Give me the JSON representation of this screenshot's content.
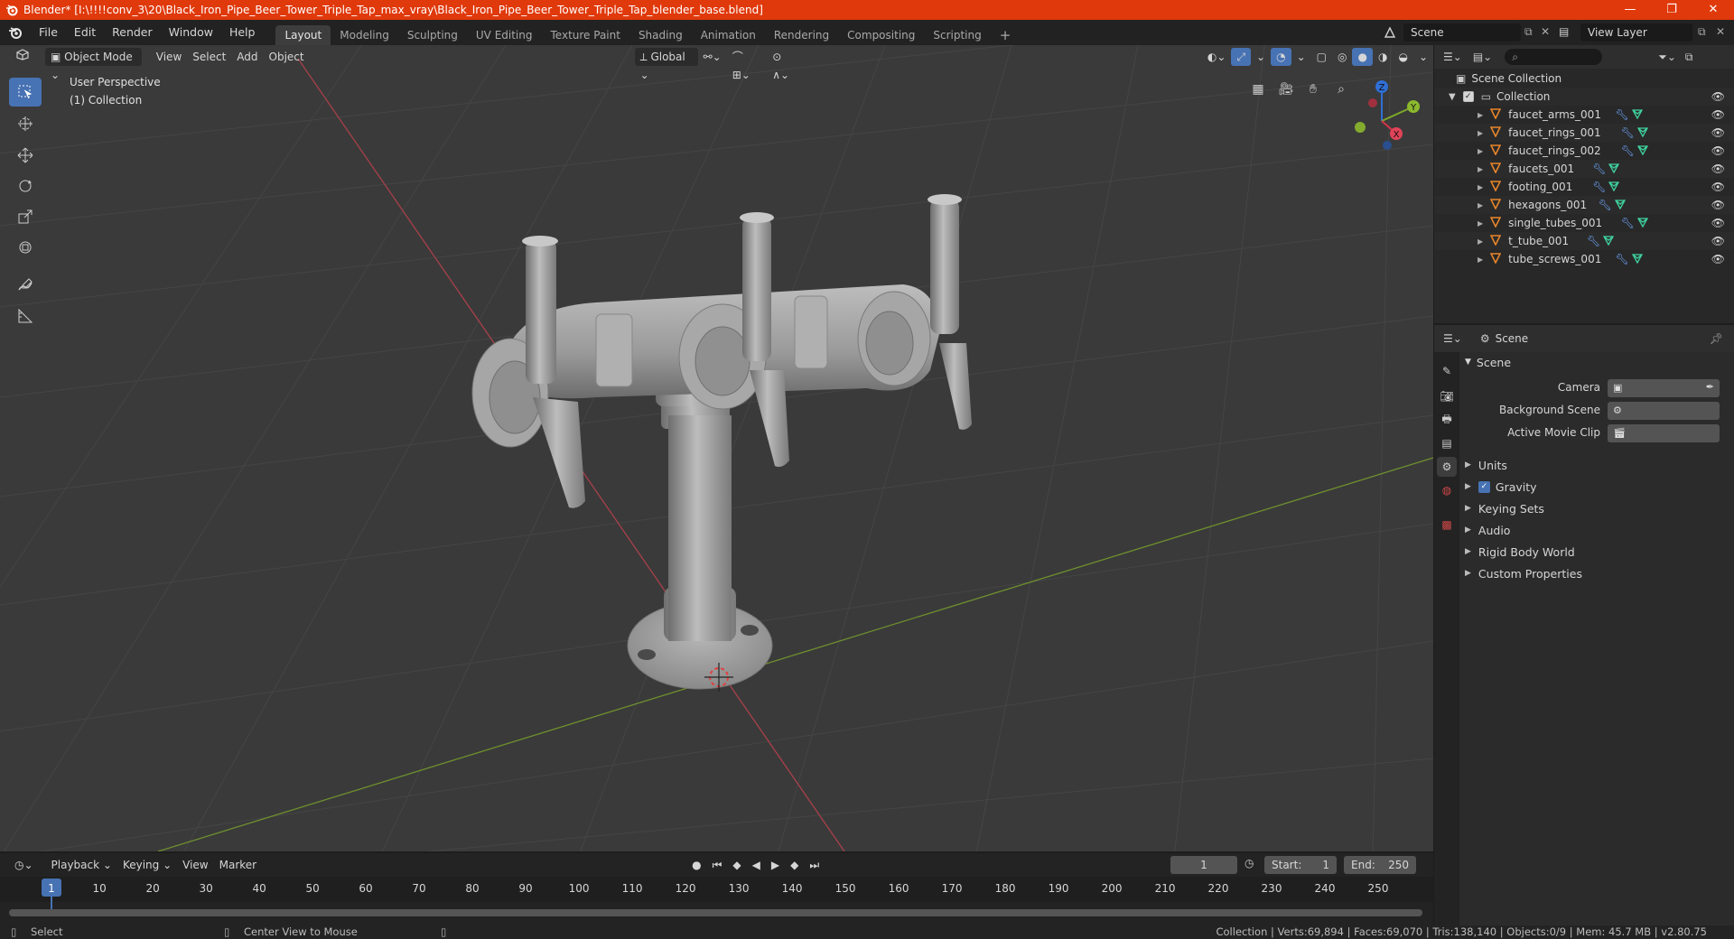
{
  "window": {
    "title": "Blender* [I:\\!!!!conv_3\\20\\Black_Iron_Pipe_Beer_Tower_Triple_Tap_max_vray\\Black_Iron_Pipe_Beer_Tower_Triple_Tap_blender_base.blend]",
    "minimize": "—",
    "maximize": "❐",
    "close": "✕"
  },
  "menu": {
    "items": [
      "File",
      "Edit",
      "Render",
      "Window",
      "Help"
    ],
    "workspaces": [
      "Layout",
      "Modeling",
      "Sculpting",
      "UV Editing",
      "Texture Paint",
      "Shading",
      "Animation",
      "Rendering",
      "Compositing",
      "Scripting"
    ],
    "add_tab": "+",
    "scene_label": "Scene",
    "view_layer_label": "View Layer"
  },
  "viewport": {
    "mode": "Object Mode",
    "menus": [
      "View",
      "Select",
      "Add",
      "Object"
    ],
    "transform_orientation": "Global",
    "perspective_label": "User Perspective",
    "collection_label": "(1) Collection",
    "gizmo": {
      "x": "X",
      "y": "Y",
      "z": "Z"
    }
  },
  "outliner": {
    "scene_collection": "Scene Collection",
    "collection": "Collection",
    "objects": [
      "faucet_arms_001",
      "faucet_rings_001",
      "faucet_rings_002",
      "faucets_001",
      "footing_001",
      "hexagons_001",
      "single_tubes_001",
      "t_tube_001",
      "tube_screws_001"
    ]
  },
  "properties": {
    "context": "Scene",
    "panel_title": "Scene",
    "camera_label": "Camera",
    "background_scene_label": "Background Scene",
    "active_movie_clip_label": "Active Movie Clip",
    "sections": [
      "Units",
      "Gravity",
      "Keying Sets",
      "Audio",
      "Rigid Body World",
      "Custom Properties"
    ],
    "gravity_checked": true
  },
  "timeline": {
    "menus": [
      "Playback",
      "Keying",
      "View",
      "Marker"
    ],
    "current_frame": "1",
    "start_label": "Start:",
    "start_value": "1",
    "end_label": "End:",
    "end_value": "250",
    "frame_ticks": [
      "1",
      "10",
      "20",
      "30",
      "40",
      "50",
      "60",
      "70",
      "80",
      "90",
      "100",
      "110",
      "120",
      "130",
      "140",
      "150",
      "160",
      "170",
      "180",
      "190",
      "200",
      "210",
      "220",
      "230",
      "240",
      "250"
    ]
  },
  "statusbar": {
    "select": "Select",
    "center_view": "Center View to Mouse",
    "stats": "Collection | Verts:69,894 | Faces:69,070 | Tris:138,140 | Objects:0/9 | Mem: 45.7 MB | v2.80.75"
  },
  "colors": {
    "titlebar": "#e0390b",
    "accent": "#4772b3",
    "object_icon": "#e8852a",
    "modifier_icon": "#6fa8ff",
    "mesh_icon": "#3fd4a0"
  }
}
